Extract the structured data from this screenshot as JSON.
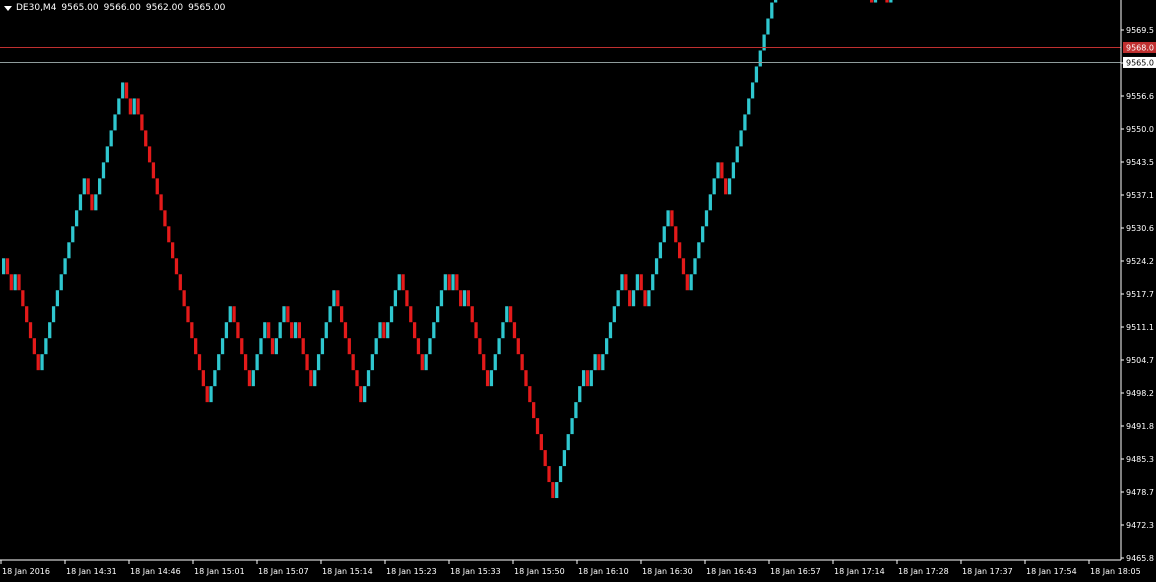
{
  "header": {
    "symbol": "DE30,M4",
    "ohlc": [
      "9565.00",
      "9566.00",
      "9562.00",
      "9565.00"
    ]
  },
  "price_labels": {
    "bid": "9565.0",
    "ask": "9568.0"
  },
  "colors": {
    "background": "#000000",
    "up": "#2fc7cf",
    "down": "#e41a1a",
    "bid_line": "#8f9c9c",
    "ask_line": "#c03030",
    "axis": "#ffffff"
  },
  "chart_data": {
    "type": "renko",
    "brick_size": 3.2,
    "ylim": [
      9465.8,
      9571.5
    ],
    "grid": false,
    "y_ticks": [
      "9569.5",
      "9563.0",
      "9556.6",
      "9550.0",
      "9543.5",
      "9537.1",
      "9530.6",
      "9524.2",
      "9517.7",
      "9511.1",
      "9504.7",
      "9498.2",
      "9491.8",
      "9485.3",
      "9478.7",
      "9472.3",
      "9465.8"
    ],
    "x_ticks": [
      "18 Jan 2016",
      "18 Jan 14:31",
      "18 Jan 14:46",
      "18 Jan 15:01",
      "18 Jan 15:07",
      "18 Jan 15:14",
      "18 Jan 15:23",
      "18 Jan 15:33",
      "18 Jan 15:50",
      "18 Jan 16:10",
      "18 Jan 16:30",
      "18 Jan 16:43",
      "18 Jan 16:57",
      "18 Jan 17:14",
      "18 Jan 17:28",
      "18 Jan 17:37",
      "18 Jan 17:54",
      "18 Jan 18:05"
    ],
    "start_price": 9522.6,
    "moves": [
      1,
      -1,
      -1,
      1,
      -1,
      -1,
      -1,
      -1,
      -1,
      -1,
      1,
      1,
      1,
      1,
      1,
      1,
      1,
      1,
      1,
      1,
      1,
      1,
      -1,
      -1,
      1,
      1,
      1,
      1,
      1,
      1,
      1,
      1,
      -1,
      -1,
      1,
      -1,
      -1,
      -1,
      -1,
      -1,
      -1,
      -1,
      -1,
      -1,
      -1,
      -1,
      -1,
      -1,
      -1,
      -1,
      -1,
      -1,
      -1,
      -1,
      1,
      1,
      1,
      1,
      1,
      1,
      -1,
      -1,
      -1,
      -1,
      -1,
      1,
      1,
      1,
      1,
      -1,
      -1,
      1,
      1,
      1,
      -1,
      -1,
      1,
      -1,
      -1,
      -1,
      -1,
      1,
      1,
      1,
      1,
      1,
      1,
      -1,
      -1,
      -1,
      -1,
      -1,
      -1,
      -1,
      1,
      1,
      1,
      1,
      1,
      -1,
      1,
      1,
      1,
      1,
      -1,
      -1,
      -1,
      -1,
      -1,
      -1,
      1,
      1,
      1,
      1,
      1,
      1,
      -1,
      1,
      -1,
      -1,
      1,
      -1,
      -1,
      -1,
      -1,
      -1,
      -1,
      1,
      1,
      1,
      1,
      1,
      -1,
      -1,
      -1,
      -1,
      -1,
      -1,
      -1,
      -1,
      -1,
      -1,
      -1,
      -1,
      1,
      1,
      1,
      1,
      1,
      1,
      1,
      1,
      -1,
      1,
      1,
      -1,
      1,
      1,
      1,
      1,
      1,
      1,
      -1,
      -1,
      1,
      1,
      -1,
      -1,
      1,
      1,
      1,
      1,
      1,
      1,
      -1,
      -1,
      -1,
      -1,
      -1,
      1,
      1,
      1,
      1,
      1,
      1,
      1,
      1,
      -1,
      -1,
      1,
      1,
      1,
      1,
      1,
      1,
      1,
      1,
      1,
      1,
      1,
      1,
      1,
      1,
      1,
      1,
      1,
      1,
      1,
      1,
      1,
      1,
      1,
      1,
      1,
      -1,
      -1,
      -1,
      -1,
      -1,
      -1,
      -1,
      -1,
      -1,
      -1,
      -1,
      -1,
      -1,
      1,
      1,
      -1,
      -1,
      1,
      1,
      1,
      1,
      1,
      1,
      1,
      1,
      1,
      -1,
      -1,
      -1,
      1,
      -1,
      1,
      1,
      1,
      1,
      1,
      -1,
      -1,
      -1,
      -1,
      -1,
      1,
      1,
      1,
      1,
      1,
      1,
      -1,
      -1,
      1,
      1,
      1,
      -1,
      -1,
      -1,
      -1,
      1,
      1,
      1,
      1,
      1,
      1,
      -1,
      -1,
      -1,
      -1,
      -1,
      1,
      1,
      1,
      1,
      1,
      1,
      -1,
      -1
    ]
  }
}
